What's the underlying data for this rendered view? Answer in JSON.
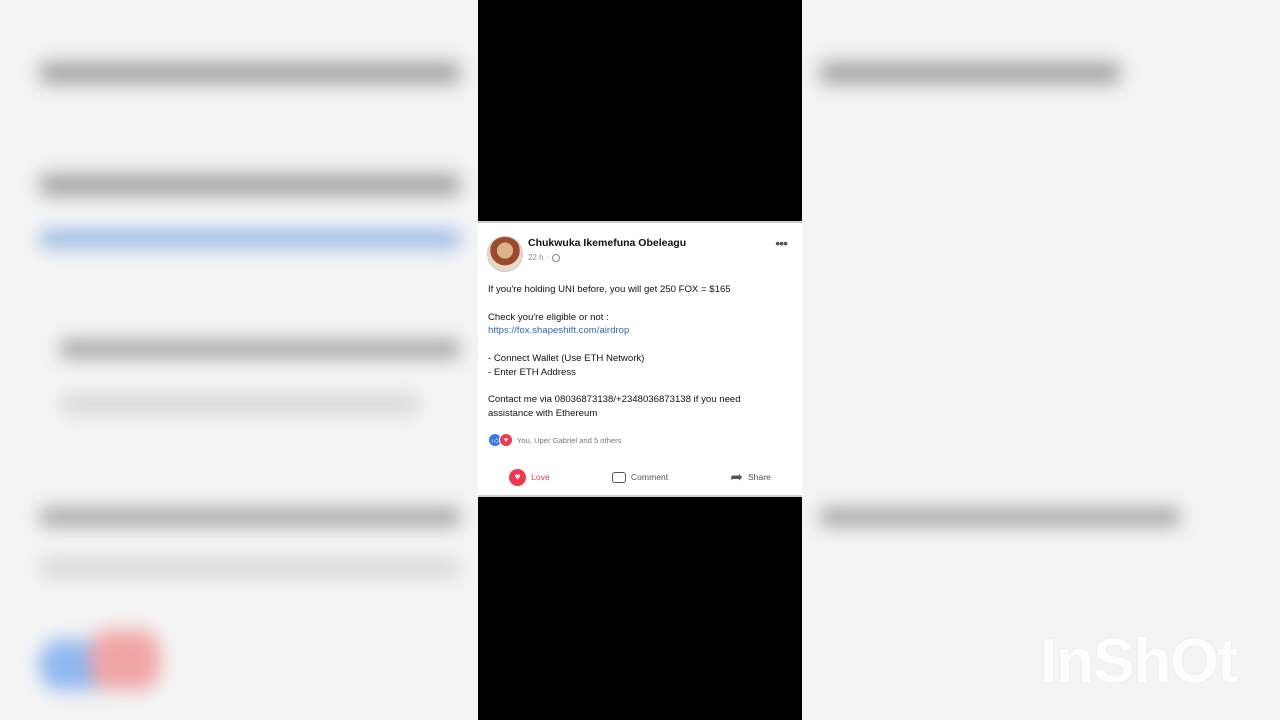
{
  "post": {
    "author": "Chukwuka Ikemefuna Obeleagu",
    "time": "22 h",
    "separator": "·",
    "more": "•••",
    "lines": [
      "If you're holding UNI before, you will get 250 FOX = $165",
      "",
      "Check you're eligible or not :",
      "https://fox.shapeshift.com/airdrop",
      "",
      "- Connect Wallet (Use ETH Network)",
      "- Enter ETH Address",
      "",
      "Contact  me via 08036873138/+2348036873138 if you need",
      "assistance with Ethereum"
    ],
    "reactions_text": "You, Uper Gabriel and 5 others",
    "actions": {
      "love": "Love",
      "comment": "Comment",
      "share": "Share"
    }
  },
  "watermark": "InShOt",
  "icons": {
    "like": "thumbs-up-icon",
    "love": "heart-icon",
    "comment": "comment-icon",
    "share": "share-arrow-icon",
    "privacy": "globe-icon"
  },
  "colors": {
    "link": "#2b6cb0",
    "love": "#f0384f",
    "like": "#3578e5"
  }
}
